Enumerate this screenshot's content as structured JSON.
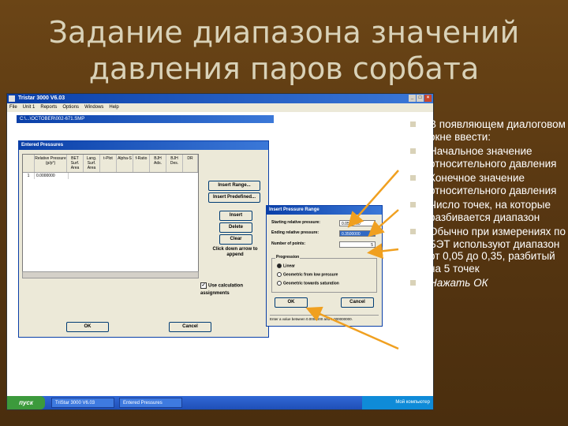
{
  "slide": {
    "title_line1": "Задание диапазона значений",
    "title_line2": "давления паров сорбата"
  },
  "app": {
    "title": "Tristar 3000 V6.03",
    "menu": [
      "File",
      "Unit 1",
      "Reports",
      "Options",
      "Windows",
      "Help"
    ],
    "file_bar": "C:\\...\\OCTOBER\\002-671.SMP"
  },
  "entered_pressures": {
    "title": "Entered Pressures",
    "columns": [
      "",
      "Relative Pressure (p/p°)",
      "BET Surf. Area",
      "Lang. Surf. Area",
      "t-Plot",
      "Alpha-S",
      "f-Ratio",
      "BJH Ads.",
      "BJH Des.",
      "DR"
    ],
    "rows": [
      {
        "num": "1",
        "pressure": "0.0000000"
      }
    ],
    "buttons": {
      "insert_range": "Insert Range...",
      "insert_predefined": "Insert Predefined...",
      "insert": "Insert",
      "delete": "Delete",
      "clear": "Clear"
    },
    "note": "Click down arrow to append",
    "checkbox_label": "Use calculation assignments",
    "ok": "OK",
    "cancel": "Cancel"
  },
  "insert_pressure_range": {
    "title": "Insert Pressure Range",
    "starting_label": "Starting relative pressure:",
    "starting_value": "0.0500000",
    "ending_label": "Ending relative pressure:",
    "ending_value": "0.3500000",
    "points_label": "Number of points:",
    "points_value": "5",
    "progression_title": "Progression",
    "progression_options": [
      "Linear",
      "Geometric from low pressure",
      "Geometric towards saturation"
    ],
    "progression_selected": 0,
    "ok": "OK",
    "cancel": "Cancel",
    "status": "Enter a value between 0.0000000 and 1.000000000."
  },
  "taskbar": {
    "start": "пуск",
    "items": [
      "TriStar 3000 V6.03",
      "Entered Pressures"
    ],
    "tray": "Мой компьютер"
  },
  "bullets": [
    "В появляющем диалоговом окне ввести:",
    "Начальное значение относительного давления",
    "Конечное значение относительного давления",
    "Число точек, на которые разбивается диапазон",
    "Обычно при измерениях по БЭТ используют диапазон от 0,05 до 0,35, разбитый на 5 точек",
    "Нажать ОК"
  ],
  "colors": {
    "background": "#5a3a12",
    "title_text": "#d9d2b8",
    "arrow": "#f0a020"
  }
}
